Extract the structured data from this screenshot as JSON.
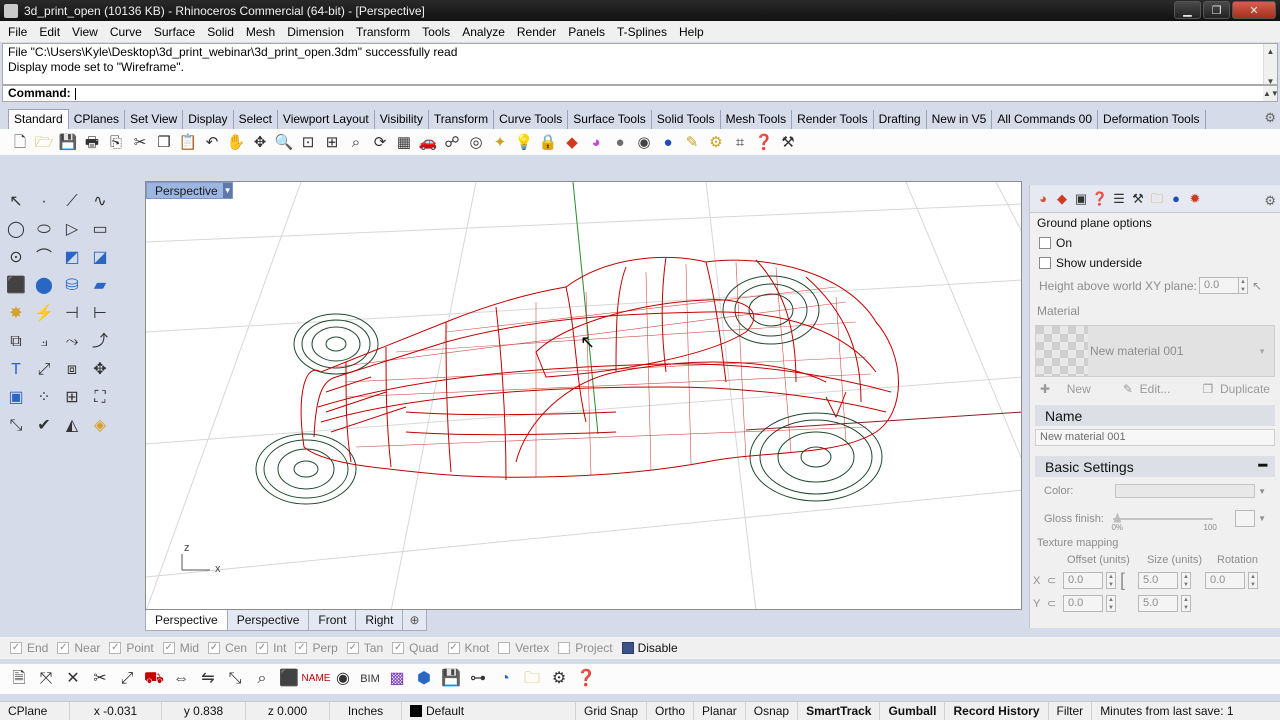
{
  "window": {
    "title": "3d_print_open (10136 KB) - Rhinoceros Commercial (64-bit) - [Perspective]",
    "minimize": "▁",
    "restore": "❐",
    "close": "✕"
  },
  "menu": [
    "File",
    "Edit",
    "View",
    "Curve",
    "Surface",
    "Solid",
    "Mesh",
    "Dimension",
    "Transform",
    "Tools",
    "Analyze",
    "Render",
    "Panels",
    "T-Splines",
    "Help"
  ],
  "history": [
    "File \"C:\\Users\\Kyle\\Desktop\\3d_print_webinar\\3d_print_open.3dm\" successfully read",
    "Display mode set to \"Wireframe\"."
  ],
  "command": {
    "label": "Command:",
    "value": ""
  },
  "toolbar_tabs": [
    "Standard",
    "CPlanes",
    "Set View",
    "Display",
    "Select",
    "Viewport Layout",
    "Visibility",
    "Transform",
    "Curve Tools",
    "Surface Tools",
    "Solid Tools",
    "Mesh Tools",
    "Render Tools",
    "Drafting",
    "New in V5",
    "All Commands 00",
    "Deformation Tools"
  ],
  "toolbar_icons": [
    "new-file",
    "open-file",
    "save",
    "print",
    "import",
    "cut",
    "copy",
    "paste",
    "undo",
    "pan",
    "move-view",
    "zoom",
    "zoom-window",
    "zoom-extents",
    "zoom-selected",
    "rotate-view",
    "four-viewports",
    "car",
    "shade",
    "circle-view",
    "point-light",
    "light",
    "lock",
    "material",
    "color-wheel",
    "sphere-grey",
    "sphere-rendered",
    "sphere-blue",
    "highlight",
    "settings",
    "grid-snap",
    "help",
    "tools"
  ],
  "viewport": {
    "label": "Perspective",
    "axis_z": "z",
    "axis_x": "x",
    "tabs": [
      "Perspective",
      "Perspective",
      "Front",
      "Right"
    ],
    "active_tab": 0
  },
  "panel": {
    "ground_plane_title": "Ground plane options",
    "on_label": "On",
    "show_underside_label": "Show underside",
    "height_label": "Height above world XY plane:",
    "height_value": "0.0",
    "material_label": "Material",
    "material_name": "New material 001",
    "new_label": "New",
    "edit_label": "Edit...",
    "duplicate_label": "Duplicate",
    "name_header": "Name",
    "name_value": "New material 001",
    "basic_header": "Basic Settings",
    "color_label": "Color:",
    "gloss_label": "Gloss finish:",
    "gloss_min": "0%",
    "gloss_max": "100",
    "texture_label": "Texture mapping",
    "offset_label": "Offset (units)",
    "size_label": "Size (units)",
    "rotation_label": "Rotation",
    "x_label": "X",
    "y_label": "Y",
    "offset_x": "0.0",
    "offset_y": "0.0",
    "size_x": "5.0",
    "size_y": "5.0",
    "rotation": "0.0"
  },
  "osnap": [
    {
      "label": "End",
      "checked": true
    },
    {
      "label": "Near",
      "checked": true
    },
    {
      "label": "Point",
      "checked": true
    },
    {
      "label": "Mid",
      "checked": true
    },
    {
      "label": "Cen",
      "checked": true
    },
    {
      "label": "Int",
      "checked": true
    },
    {
      "label": "Perp",
      "checked": true
    },
    {
      "label": "Tan",
      "checked": true
    },
    {
      "label": "Quad",
      "checked": true
    },
    {
      "label": "Knot",
      "checked": true
    },
    {
      "label": "Vertex",
      "checked": false
    },
    {
      "label": "Project",
      "checked": false
    }
  ],
  "osnap_disable": "Disable",
  "status": {
    "cplane": "CPlane",
    "x": "x -0.031",
    "y": "y 0.838",
    "z": "z 0.000",
    "units": "Inches",
    "layer": "Default",
    "grid_snap": "Grid Snap",
    "ortho": "Ortho",
    "planar": "Planar",
    "osnap": "Osnap",
    "smarttrack": "SmartTrack",
    "gumball": "Gumball",
    "record_history": "Record History",
    "filter": "Filter",
    "minutes": "Minutes from last save: 1"
  },
  "colors": {
    "wire_body": "#c40000",
    "wire_wheels": "#1f4a2e",
    "viewport_label": "#9db6e0",
    "accent_blue": "#3b5487"
  }
}
